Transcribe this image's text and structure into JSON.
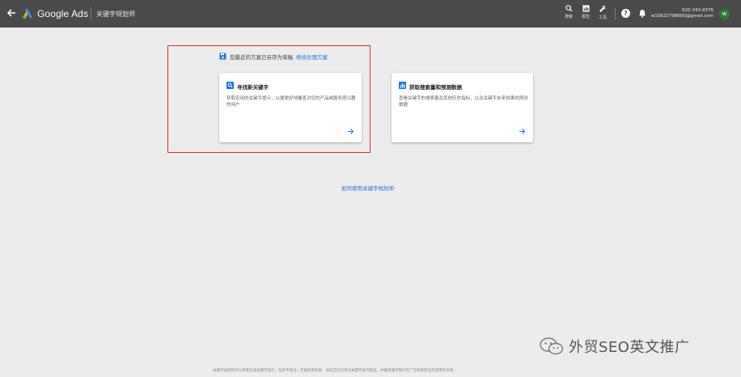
{
  "header": {
    "back_icon": "arrow-left-icon",
    "logo_icon": "google-ads-logo",
    "app_title": "Google Ads",
    "page_name": "关键字规划师",
    "tools": [
      {
        "icon": "search-icon",
        "label": "搜索"
      },
      {
        "icon": "reports-icon",
        "label": "报告"
      },
      {
        "icon": "wrench-icon",
        "label": "工具"
      }
    ],
    "help_icon": "help-circle-icon",
    "notifications_icon": "bell-icon",
    "account_id": "620-343-9376",
    "account_email": "w15622798600@gmail.com",
    "avatar_letter": "w"
  },
  "draft_notice": {
    "icon": "save-icon",
    "text": "您最近的方案已另存为草稿",
    "link": "继续处理方案"
  },
  "cards": [
    {
      "icon": "search-box-icon",
      "title": "寻找新关键字",
      "description": "获取实用的关键字提示，以便更好地覆盖对您的产品或服务感兴趣的用户"
    },
    {
      "icon": "bar-chart-icon",
      "title": "获取搜索量和预测数据",
      "description": "查看关键字的搜索量及其他历史指标，以及关键字未来效果的预测数据"
    }
  ],
  "help_link": "如何使用关键字规划师",
  "watermark": {
    "icon": "wechat-icon",
    "text": "外贸SEO英文推广"
  },
  "footer_note": "关键字规划师可以用来生成关键字提示，但并不保证一定能改善效果。请您自行负责对关键字进行甄选，并确保遵守我们的广告政策及任何适用的法律。",
  "colors": {
    "topbar": "#4a4a4a",
    "background": "#ececec",
    "link": "#1a73e8",
    "highlight": "#d93025",
    "avatar": "#2e7d32"
  }
}
